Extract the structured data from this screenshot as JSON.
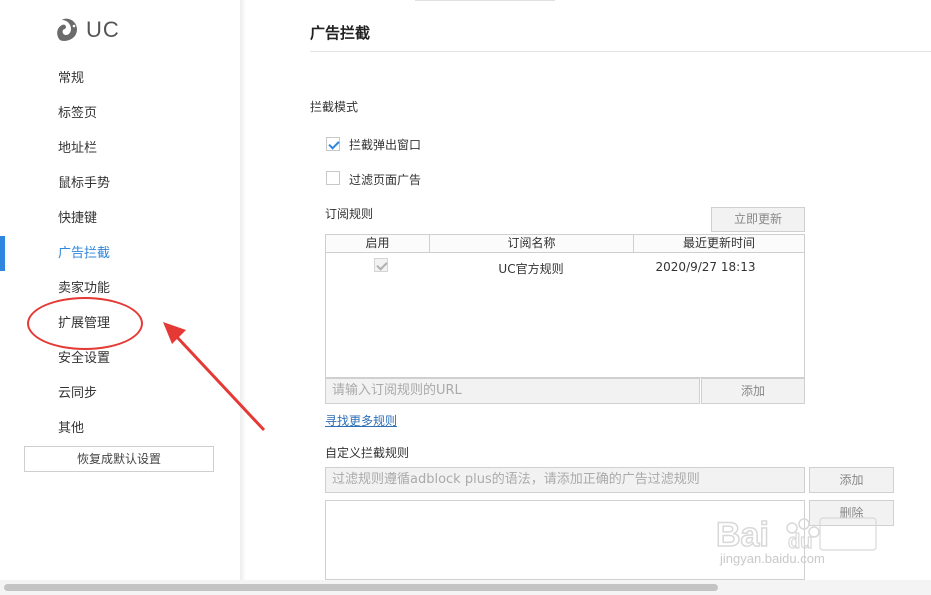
{
  "logo": {
    "text": "UC"
  },
  "sidebar": {
    "items": [
      {
        "label": "常规"
      },
      {
        "label": "标签页"
      },
      {
        "label": "地址栏"
      },
      {
        "label": "鼠标手势"
      },
      {
        "label": "快捷键"
      },
      {
        "label": "广告拦截",
        "active": true
      },
      {
        "label": "卖家功能"
      },
      {
        "label": "扩展管理"
      },
      {
        "label": "安全设置"
      },
      {
        "label": "云同步"
      },
      {
        "label": "其他"
      }
    ],
    "reset_label": "恢复成默认设置"
  },
  "main": {
    "title": "广告拦截",
    "mode_label": "拦截模式",
    "block_popup_label": "拦截弹出窗口",
    "block_popup_checked": true,
    "filter_ads_label": "过滤页面广告",
    "filter_ads_checked": false,
    "subscription_label": "订阅规则",
    "update_now_label": "立即更新",
    "table": {
      "headers": [
        "启用",
        "订阅名称",
        "最近更新时间"
      ],
      "rows": [
        {
          "enabled": true,
          "name": "UC官方规则",
          "updated": "2020/9/27 18:13"
        }
      ]
    },
    "url_placeholder": "请输入订阅规则的URL",
    "add_label": "添加",
    "find_more_label": "寻找更多规则",
    "custom_label": "自定义拦截规则",
    "custom_placeholder": "过滤规则遵循adblock plus的语法，请添加正确的广告过滤规则",
    "custom_add_label": "添加",
    "delete_label": "删除"
  },
  "watermark": {
    "text": "jingyan.baidu.com",
    "brand": "Baidu经验"
  },
  "colors": {
    "accent": "#2e86de",
    "annotation": "#e53935"
  }
}
